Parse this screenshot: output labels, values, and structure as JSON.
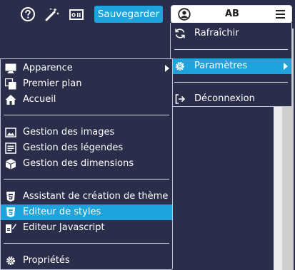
{
  "toolbar": {
    "help_icon": "question-circle-icon",
    "magic_icon": "magic-wand-icon",
    "image_icon": "image-icon",
    "save_label": "Sauvegarder"
  },
  "user": {
    "initials": "AB",
    "icon": "user-circle-icon",
    "menu_icon": "hamburger-icon"
  },
  "user_menu": {
    "items": [
      {
        "label": "Rafraîchir",
        "icon": "refresh-icon"
      },
      {
        "label": "Paramètres",
        "icon": "gear-icon",
        "active": true,
        "has_submenu": true
      },
      {
        "label": "Déconnexion",
        "icon": "logout-icon"
      }
    ]
  },
  "settings_menu": {
    "items": [
      {
        "label": "Apparence",
        "icon": "monitor-icon",
        "has_submenu": true
      },
      {
        "label": "Premier plan",
        "icon": "layers-icon"
      },
      {
        "label": "Accueil",
        "icon": "home-icon"
      },
      {
        "label": "Gestion des images",
        "icon": "image-icon"
      },
      {
        "label": "Gestion des légendes",
        "icon": "caption-icon"
      },
      {
        "label": "Gestion des dimensions",
        "icon": "cube-icon"
      },
      {
        "label": "Assistant de création de thème",
        "icon": "css3-icon"
      },
      {
        "label": "Editeur de styles",
        "icon": "css3-icon",
        "active": true
      },
      {
        "label": "Editeur Javascript",
        "icon": "js-edit-icon"
      },
      {
        "label": "Propriétés",
        "icon": "gear-icon"
      }
    ]
  },
  "colors": {
    "background": "#2b2e4a",
    "accent": "#1fa3dc",
    "text": "#ffffff"
  }
}
